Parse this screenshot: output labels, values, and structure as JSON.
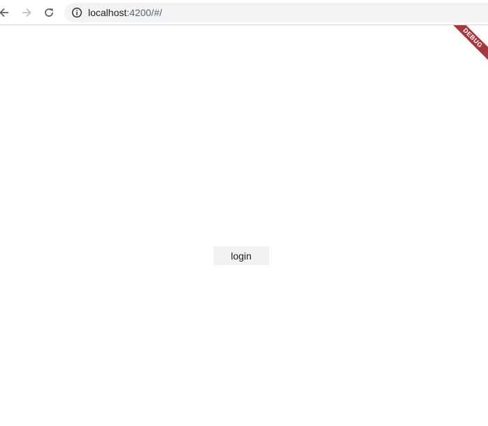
{
  "browser": {
    "url_host": "localhost",
    "url_path": ":4200/#/",
    "back_icon": "arrow-left-icon",
    "forward_icon": "arrow-right-icon",
    "reload_icon": "reload-icon",
    "info_icon": "info-icon"
  },
  "page": {
    "login_label": "login",
    "debug_label": "DEBUG",
    "debug_color": "#a6393f"
  }
}
